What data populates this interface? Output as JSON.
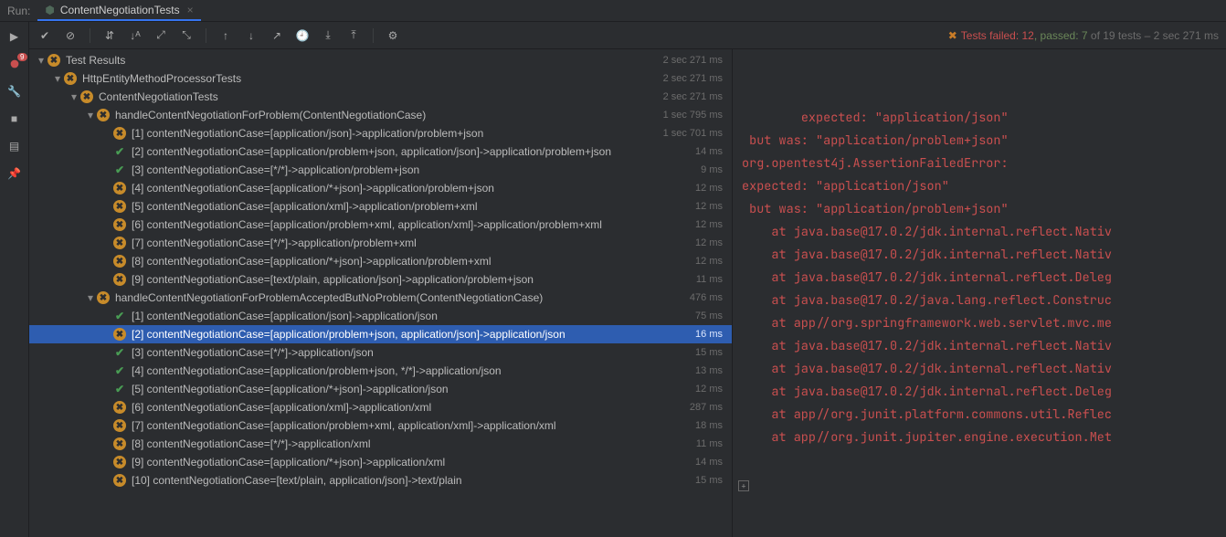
{
  "tab": {
    "run_label": "Run:",
    "title": "ContentNegotiationTests"
  },
  "status": {
    "prefix": "Tests failed: ",
    "failed": "12",
    "passed_prefix": ", passed: ",
    "passed": "7",
    "suffix": " of 19 tests – 2 sec 271 ms"
  },
  "tree": [
    {
      "depth": 0,
      "arrow": true,
      "status": "fail",
      "label": "Test Results",
      "time": "2 sec 271 ms",
      "selected": false
    },
    {
      "depth": 1,
      "arrow": true,
      "status": "fail",
      "label": "HttpEntityMethodProcessorTests",
      "time": "2 sec 271 ms",
      "selected": false
    },
    {
      "depth": 2,
      "arrow": true,
      "status": "fail",
      "label": "ContentNegotiationTests",
      "time": "2 sec 271 ms",
      "selected": false
    },
    {
      "depth": 3,
      "arrow": true,
      "status": "fail",
      "label": "handleContentNegotiationForProblem(ContentNegotiationCase)",
      "time": "1 sec 795 ms",
      "selected": false
    },
    {
      "depth": 4,
      "arrow": false,
      "status": "fail",
      "label": "[1] contentNegotiationCase=[application/json]->application/problem+json",
      "time": "1 sec 701 ms",
      "selected": false
    },
    {
      "depth": 4,
      "arrow": false,
      "status": "pass",
      "label": "[2] contentNegotiationCase=[application/problem+json, application/json]->application/problem+json",
      "time": "14 ms",
      "selected": false
    },
    {
      "depth": 4,
      "arrow": false,
      "status": "pass",
      "label": "[3] contentNegotiationCase=[*/*]->application/problem+json",
      "time": "9 ms",
      "selected": false
    },
    {
      "depth": 4,
      "arrow": false,
      "status": "fail",
      "label": "[4] contentNegotiationCase=[application/*+json]->application/problem+json",
      "time": "12 ms",
      "selected": false
    },
    {
      "depth": 4,
      "arrow": false,
      "status": "fail",
      "label": "[5] contentNegotiationCase=[application/xml]->application/problem+xml",
      "time": "12 ms",
      "selected": false
    },
    {
      "depth": 4,
      "arrow": false,
      "status": "fail",
      "label": "[6] contentNegotiationCase=[application/problem+xml, application/xml]->application/problem+xml",
      "time": "12 ms",
      "selected": false
    },
    {
      "depth": 4,
      "arrow": false,
      "status": "fail",
      "label": "[7] contentNegotiationCase=[*/*]->application/problem+xml",
      "time": "12 ms",
      "selected": false
    },
    {
      "depth": 4,
      "arrow": false,
      "status": "fail",
      "label": "[8] contentNegotiationCase=[application/*+json]->application/problem+xml",
      "time": "12 ms",
      "selected": false
    },
    {
      "depth": 4,
      "arrow": false,
      "status": "fail",
      "label": "[9] contentNegotiationCase=[text/plain, application/json]->application/problem+json",
      "time": "11 ms",
      "selected": false
    },
    {
      "depth": 3,
      "arrow": true,
      "status": "fail",
      "label": "handleContentNegotiationForProblemAcceptedButNoProblem(ContentNegotiationCase)",
      "time": "476 ms",
      "selected": false
    },
    {
      "depth": 4,
      "arrow": false,
      "status": "pass",
      "label": "[1] contentNegotiationCase=[application/json]->application/json",
      "time": "75 ms",
      "selected": false
    },
    {
      "depth": 4,
      "arrow": false,
      "status": "fail",
      "label": "[2] contentNegotiationCase=[application/problem+json, application/json]->application/json",
      "time": "16 ms",
      "selected": true
    },
    {
      "depth": 4,
      "arrow": false,
      "status": "pass",
      "label": "[3] contentNegotiationCase=[*/*]->application/json",
      "time": "15 ms",
      "selected": false
    },
    {
      "depth": 4,
      "arrow": false,
      "status": "pass",
      "label": "[4] contentNegotiationCase=[application/problem+json, */*]->application/json",
      "time": "13 ms",
      "selected": false
    },
    {
      "depth": 4,
      "arrow": false,
      "status": "pass",
      "label": "[5] contentNegotiationCase=[application/*+json]->application/json",
      "time": "12 ms",
      "selected": false
    },
    {
      "depth": 4,
      "arrow": false,
      "status": "fail",
      "label": "[6] contentNegotiationCase=[application/xml]->application/xml",
      "time": "287 ms",
      "selected": false
    },
    {
      "depth": 4,
      "arrow": false,
      "status": "fail",
      "label": "[7] contentNegotiationCase=[application/problem+xml, application/xml]->application/xml",
      "time": "18 ms",
      "selected": false
    },
    {
      "depth": 4,
      "arrow": false,
      "status": "fail",
      "label": "[8] contentNegotiationCase=[*/*]->application/xml",
      "time": "11 ms",
      "selected": false
    },
    {
      "depth": 4,
      "arrow": false,
      "status": "fail",
      "label": "[9] contentNegotiationCase=[application/*+json]->application/xml",
      "time": "14 ms",
      "selected": false
    },
    {
      "depth": 4,
      "arrow": false,
      "status": "fail",
      "label": "[10] contentNegotiationCase=[text/plain, application/json]->text/plain",
      "time": "15 ms",
      "selected": false
    }
  ],
  "console": "expected: \"application/json\"\n but was: \"application/problem+json\"\norg.opentest4j.AssertionFailedError: \nexpected: \"application/json\"\n but was: \"application/problem+json\"\n    at java.base@17.0.2/jdk.internal.reflect.Nativ\n    at java.base@17.0.2/jdk.internal.reflect.Nativ\n    at java.base@17.0.2/jdk.internal.reflect.Deleg\n    at java.base@17.0.2/java.lang.reflect.Construc\n    at app//org.springframework.web.servlet.mvc.me\n    at java.base@17.0.2/jdk.internal.reflect.Nativ\n    at java.base@17.0.2/jdk.internal.reflect.Nativ\n    at java.base@17.0.2/jdk.internal.reflect.Deleg\n    at app//org.junit.platform.commons.util.Reflec\n    at app//org.junit.jupiter.engine.execution.Met"
}
